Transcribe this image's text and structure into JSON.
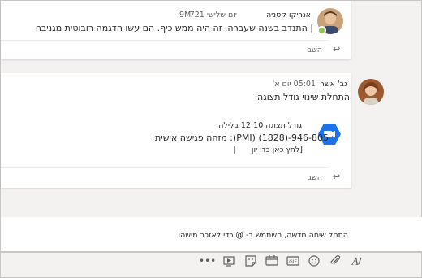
{
  "messages": [
    {
      "author": "אנריקו קטניה",
      "timestamp": "יום שלישי 721",
      "timestamp_suffix": "9M",
      "text": "| התנדב בשנה שעברה. זה היה ממש כיף. הם עשו הדגמה רובוטית מגניבה",
      "reply_label": "השב",
      "avatar_icon": "person-avatar",
      "presence": "available"
    },
    {
      "author": "גב' אשר",
      "timestamp": "05:01 יום א'",
      "text": "התחלת שינוי גודל תצוגה",
      "meeting": {
        "header": "גודל תצוגה 12:10 בלילה",
        "id_line": "מזהה פגישה אישית :(PMI) (1828)-946-805",
        "link_text": "[לחץ כאן כדי יון"
      },
      "reply_label": "השב",
      "avatar_icon": "person-avatar"
    }
  ],
  "compose": {
    "placeholder": "התחל שיחה חדשה, השתמש ב- @ כדי לאזכר מישהו"
  },
  "toolbar": {
    "icons": [
      "more-options-icon",
      "stream-icon",
      "sticker-icon",
      "meet-now-icon",
      "gif-icon",
      "emoji-icon",
      "attach-icon",
      "format-icon"
    ]
  },
  "colors": {
    "accent": "#6264a7",
    "camera_badge": "#1a73e8",
    "presence_available": "#92c353"
  }
}
